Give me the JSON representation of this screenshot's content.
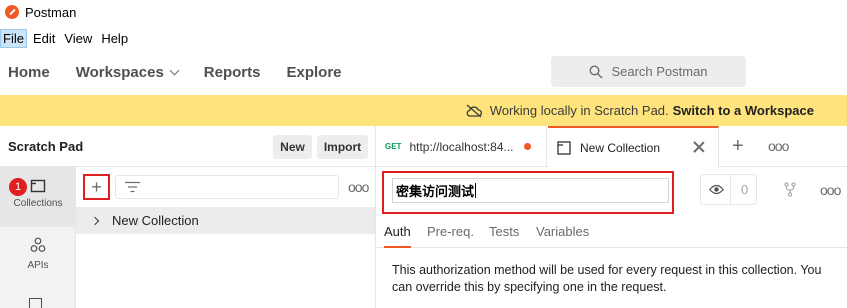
{
  "app": {
    "title": "Postman"
  },
  "menu": {
    "items": [
      "File",
      "Edit",
      "View",
      "Help"
    ]
  },
  "nav": {
    "home": "Home",
    "workspaces": "Workspaces",
    "reports": "Reports",
    "explore": "Explore",
    "search_placeholder": "Search Postman"
  },
  "banner": {
    "text": "Working locally in Scratch Pad.",
    "link": "Switch to a Workspace"
  },
  "sidebar": {
    "title": "Scratch Pad",
    "new_label": "New",
    "import_label": "Import",
    "items": [
      {
        "label": "Collections",
        "icon": "collections-icon",
        "badge": "1"
      },
      {
        "label": "APIs",
        "icon": "apis-icon"
      }
    ],
    "tree": [
      {
        "label": "New Collection"
      }
    ]
  },
  "tabs": [
    {
      "method": "GET",
      "label": "http://localhost:84...",
      "unsaved": true
    },
    {
      "label": "New Collection",
      "icon": "document-icon"
    }
  ],
  "collection": {
    "name": "密集访问测试",
    "watch_count": "0"
  },
  "subtabs": [
    "Auth",
    "Pre-req.",
    "Tests",
    "Variables"
  ],
  "auth": {
    "description": "This authorization method will be used for every request in this collection. You can override this by specifying one in the request."
  },
  "colors": {
    "accent": "#ef5b25",
    "banner": "#ffe47e",
    "highlight": "#e02020",
    "method_get": "#0f9d58"
  }
}
